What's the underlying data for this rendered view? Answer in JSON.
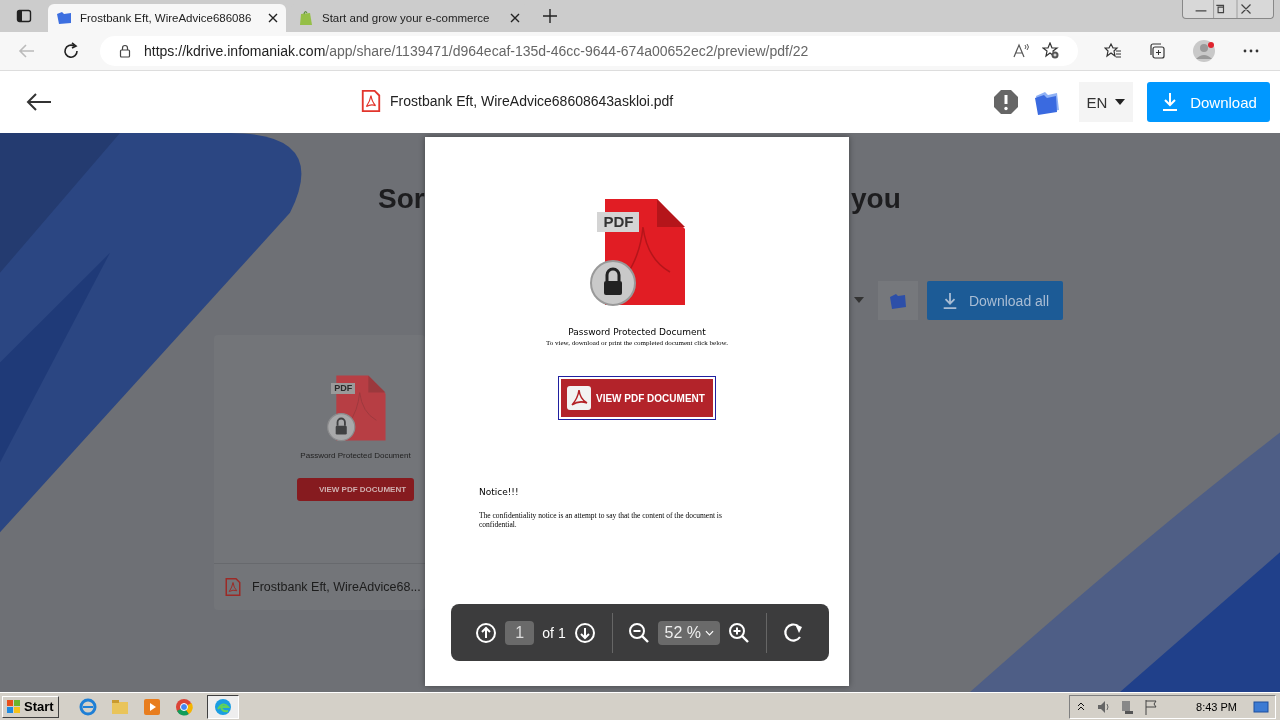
{
  "browser": {
    "tabs": [
      {
        "title": "Frostbank Eft, WireAdvice686086",
        "selected": true
      },
      {
        "title": "Start and grow your e-commerce",
        "selected": false
      }
    ],
    "url": {
      "host": "https://kdrive.infomaniak.com",
      "path": "/app/share/1139471/d964ecaf-135d-46cc-9644-674a00652ec2/preview/pdf/22"
    }
  },
  "header": {
    "file_name": "Frostbank Eft, WireAdvice68608643askloi.pdf",
    "language": "EN",
    "download_label": "Download"
  },
  "background": {
    "heading_parts": [
      "Sor",
      "you"
    ],
    "download_all_label": "Download all",
    "file_card": {
      "file_name": "Frostbank Eft, WireAdvice68...",
      "thumbnail_badge": "PDF",
      "thumbnail_title": "Password Protected Document",
      "thumbnail_button": "VIEW PDF DOCUMENT"
    }
  },
  "document": {
    "badge": "PDF",
    "title": "Password Protected Document",
    "subtitle": "To view, download or print the completed document click below.",
    "button": "VIEW PDF DOCUMENT",
    "notice_title": "Notice!!!",
    "notice_text": "The confidentiality notice is an attempt to say that the content of the document is confidential."
  },
  "viewer_toolbar": {
    "page": "1",
    "page_count": "of 1",
    "zoom": "52 %"
  },
  "taskbar": {
    "start": "Start",
    "time": "8:43 PM"
  }
}
